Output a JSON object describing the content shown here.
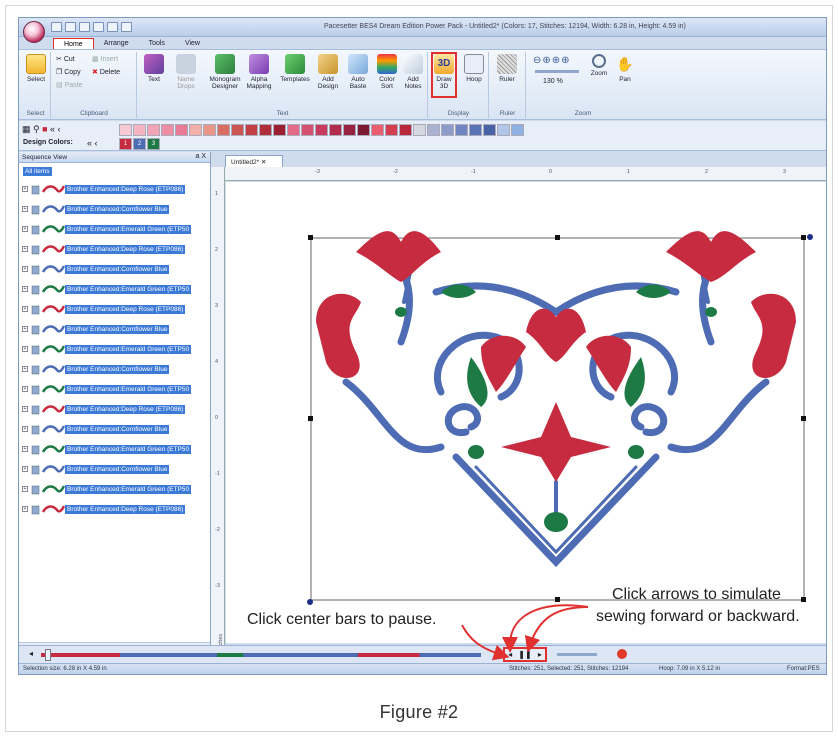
{
  "app": {
    "title": "Pacesetter BES4 Dream Edition Power Pack - Untitled2* (Colors: 17, Stitches: 12194, Width: 6.28 in, Height: 4.59 in)",
    "menu_tabs": [
      "Home",
      "Arrange",
      "Tools",
      "View"
    ],
    "active_tab": "Home",
    "ribbon": {
      "select_label": "Select",
      "clipboard": {
        "cut": "Cut",
        "copy": "Copy",
        "paste": "Paste",
        "insert": "Insert",
        "delete": "Delete",
        "group": "Clipboard"
      },
      "select_group": "Select",
      "text_group": {
        "items": [
          "Text",
          "Name Drops",
          "Monogram Designer",
          "Alpha Mapping",
          "Templates",
          "Add Design",
          "Auto Baste",
          "Color Sort",
          "Add Notes"
        ],
        "group": "Text"
      },
      "display_group": {
        "items": [
          "Draw 3D",
          "Hoop"
        ],
        "group": "Display"
      },
      "ruler_group": {
        "item": "Ruler",
        "group": "Ruler"
      },
      "zoom_group": {
        "zoom_value": "130 %",
        "items": [
          "Zoom",
          "Pan"
        ],
        "group": "Zoom"
      }
    },
    "palette": {
      "design_colors_label": "Design Colors:",
      "design_colors": [
        "1",
        "2",
        "3"
      ],
      "colors": [
        "#f7c9d2",
        "#f5b4c0",
        "#f3a3b6",
        "#ee8ea4",
        "#e87b97",
        "#f2b0a8",
        "#e99588",
        "#d96f64",
        "#cc5452",
        "#c33e45",
        "#b02e3a",
        "#9b1f30",
        "#e26a86",
        "#d6506f",
        "#c93b5c",
        "#b12d4c",
        "#972340",
        "#7d1a33",
        "#e95f70",
        "#d33f50",
        "#b8273a",
        "#d7d7e0",
        "#a9b2cf",
        "#8d9bc9",
        "#6f86c2",
        "#5a73b5",
        "#4a62a6",
        "#b0c7ea",
        "#8fb1e2"
      ],
      "design_color_hex": [
        "#c72b40",
        "#4d6cb4",
        "#1e7a45"
      ]
    },
    "sequence_view": {
      "title": "Sequence View",
      "controls": "a  X",
      "all_items": "All items",
      "items": [
        "Brother Enhanced:Deep Rose (ETP086)",
        "Brother Enhanced:Cornflower Blue",
        "Brother Enhanced:Emerald Green (ETP50",
        "Brother Enhanced:Deep Rose (ETP086)",
        "Brother Enhanced:Cornflower Blue",
        "Brother Enhanced:Emerald Green (ETP50",
        "Brother Enhanced:Deep Rose (ETP086)",
        "Brother Enhanced:Cornflower Blue",
        "Brother Enhanced:Emerald Green (ETP50",
        "Brother Enhanced:Cornflower Blue",
        "Brother Enhanced:Emerald Green (ETP50",
        "Brother Enhanced:Deep Rose (ETP086)",
        "Brother Enhanced:Cornflower Blue",
        "Brother Enhanced:Emerald Green (ETP50",
        "Brother Enhanced:Cornflower Blue",
        "Brother Enhanced:Emerald Green (ETP50",
        "Brother Enhanced:Deep Rose (ETP086)"
      ]
    },
    "document_tab": "Untitled2*",
    "ruler_top": [
      "-3",
      "-2",
      "-1",
      "0",
      "1",
      "2",
      "3"
    ],
    "ruler_left": [
      "1",
      "2",
      "3",
      "4",
      "0",
      "-1",
      "-2",
      "-3"
    ],
    "ruler_unit": "Inches",
    "status": {
      "selection_size": "Selection size: 6.28 in X 4.59 in",
      "stitch_info": "Stitches: 251, Selected: 251, Stitches: 12194",
      "hoop": "Hoop: 7.09 in X 5.12 in",
      "format": "Format:PES"
    }
  },
  "callouts": {
    "pause": "Click center bars to pause.",
    "arrows_line1": "Click arrows to simulate",
    "arrows_line2": "sewing forward or backward."
  },
  "caption": "Figure #2",
  "colors": {
    "rose": "#c72b40",
    "blue": "#4d6cb4",
    "green": "#1e7a45",
    "highlight_red": "#e03030"
  }
}
